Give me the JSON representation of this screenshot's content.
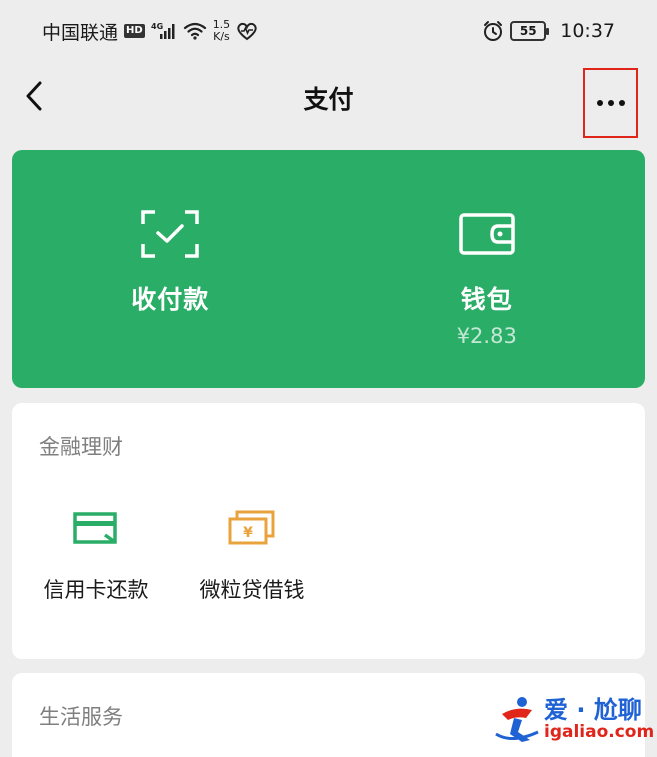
{
  "status_bar": {
    "carrier": "中国联通",
    "hd_badge": "HD",
    "network_type": "4G",
    "speed_value": "1.5",
    "speed_unit": "K/s",
    "battery": "55",
    "time": "10:37",
    "icons": [
      "signal-icon",
      "wifi-icon",
      "heart-icon",
      "alarm-icon"
    ]
  },
  "nav": {
    "title": "支付",
    "back_icon": "chevron-left-icon",
    "more_icon": "more-dots-icon",
    "highlight_color": "#e0261b"
  },
  "pay_card": {
    "background": "#2aae67",
    "actions": [
      {
        "label": "收付款",
        "icon": "scan-check-icon"
      },
      {
        "label": "钱包",
        "icon": "wallet-icon",
        "balance": "¥2.83"
      }
    ]
  },
  "finance_section": {
    "title": "金融理财",
    "items": [
      {
        "label": "信用卡还款",
        "icon": "credit-card-icon",
        "color": "#2aae67"
      },
      {
        "label": "微粒贷借钱",
        "icon": "yuan-bills-icon",
        "color": "#e8a33c"
      }
    ]
  },
  "life_section": {
    "title": "生活服务"
  },
  "watermark": {
    "title": "爱 · 尬聊",
    "url": "igaliao.com"
  }
}
